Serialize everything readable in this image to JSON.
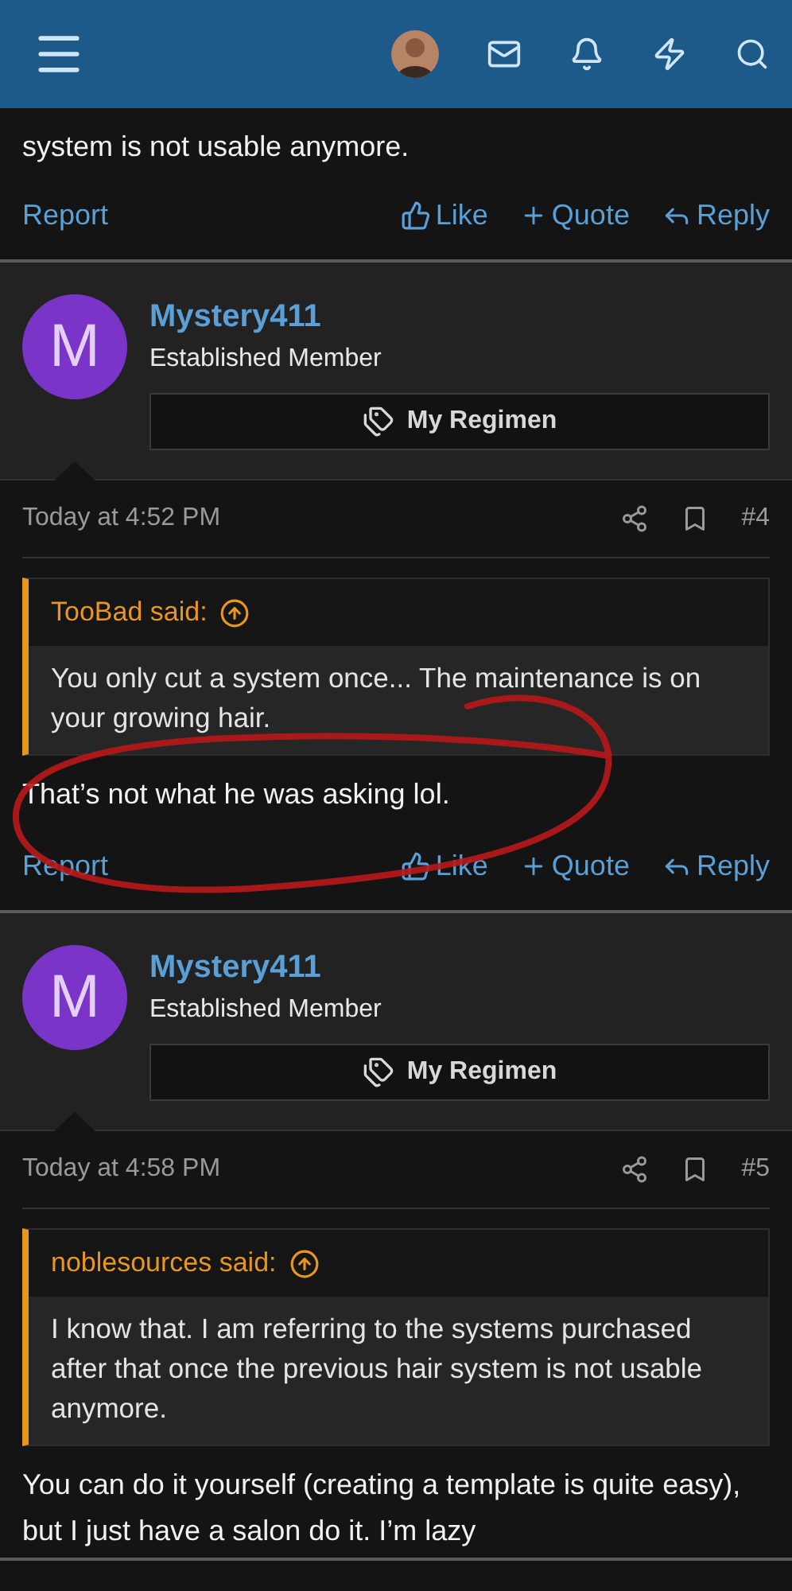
{
  "header": {
    "has_avatar": true
  },
  "fragment": {
    "text": "system is not usable anymore.",
    "actions": [
      {
        "kind": "report",
        "label": "Report"
      },
      {
        "kind": "like",
        "label": "Like"
      },
      {
        "kind": "quote",
        "label": "Quote"
      },
      {
        "kind": "reply",
        "label": "Reply"
      }
    ]
  },
  "posts": [
    {
      "author": "Mystery411",
      "avatar_letter": "M",
      "role": "Established Member",
      "banner": "My Regimen",
      "time": "Today at 4:52 PM",
      "number": "#4",
      "quote": {
        "attribution": "TooBad said:",
        "text": "You only cut a system once... The maintenance is on your growing hair."
      },
      "message": "That’s not what he was asking lol.",
      "circled": true,
      "actions": [
        {
          "kind": "report",
          "label": "Report"
        },
        {
          "kind": "like",
          "label": "Like"
        },
        {
          "kind": "quote",
          "label": "Quote"
        },
        {
          "kind": "reply",
          "label": "Reply"
        }
      ]
    },
    {
      "author": "Mystery411",
      "avatar_letter": "M",
      "role": "Established Member",
      "banner": "My Regimen",
      "time": "Today at 4:58 PM",
      "number": "#5",
      "quote": {
        "attribution": "noblesources said:",
        "text": "I know that. I am referring to the systems purchased after that once the previous hair system is not usable anymore."
      },
      "message": "You can do it yourself (creating a template is quite easy), but I just have a salon do it. I’m lazy",
      "circled": false
    }
  ]
}
